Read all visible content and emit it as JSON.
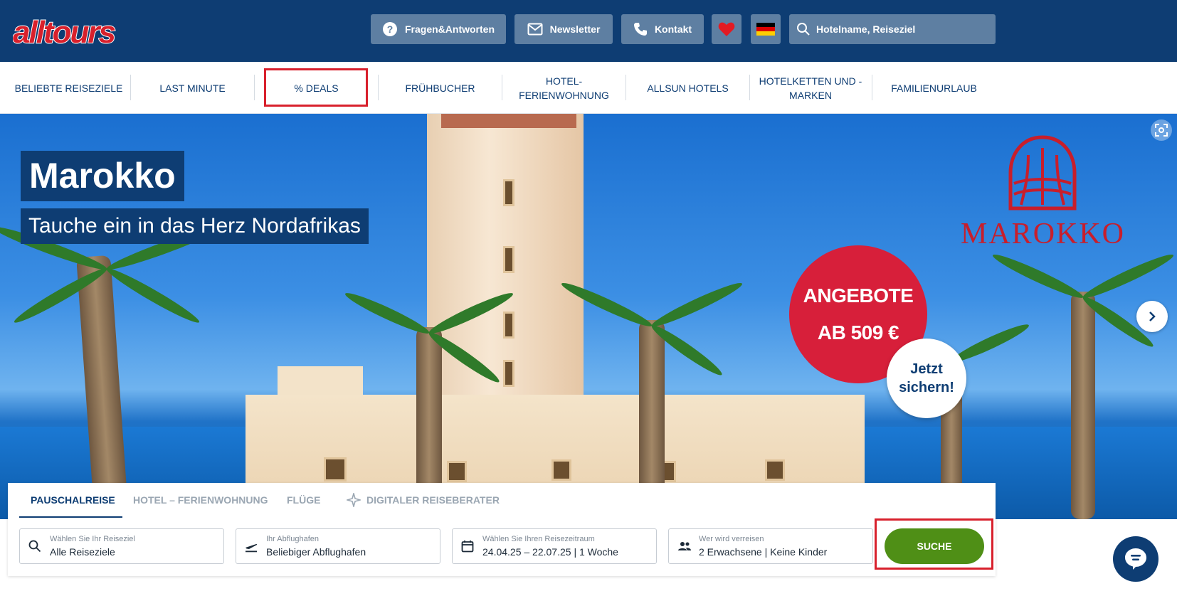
{
  "header": {
    "logo_text": "alltours",
    "faq_label": "Fragen&Antworten",
    "newsletter_label": "Newsletter",
    "contact_label": "Kontakt",
    "search_placeholder": "Hotelname, Reiseziel"
  },
  "nav": {
    "items": [
      {
        "label": "BELIEBTE REISEZIELE"
      },
      {
        "label": "LAST MINUTE"
      },
      {
        "label": "% DEALS"
      },
      {
        "label": "FRÜHBUCHER"
      },
      {
        "label": "HOTEL-\nFERIENWOHNUNG"
      },
      {
        "label": "ALLSUN HOTELS"
      },
      {
        "label": "HOTELKETTEN UND -\nMARKEN"
      },
      {
        "label": "FAMILIENURLAUB"
      }
    ]
  },
  "hero": {
    "title": "Marokko",
    "subtitle": "Tauche ein in das Herz Nordafrikas",
    "brand": "MAROKKO",
    "offer_line1": "ANGEBOTE",
    "offer_line2": "AB 509 €",
    "cta_line1": "Jetzt",
    "cta_line2": "sichern!"
  },
  "search": {
    "tabs": [
      {
        "label": "PAUSCHALREISE"
      },
      {
        "label": "HOTEL – FERIENWOHNUNG"
      },
      {
        "label": "FLÜGE"
      },
      {
        "label": "DIGITALER REISEBERATER"
      }
    ],
    "destination": {
      "label": "Wählen Sie Ihr Reiseziel",
      "value": "Alle Reiseziele"
    },
    "airport": {
      "label": "Ihr Abflughafen",
      "value": "Beliebiger Abflughafen"
    },
    "period": {
      "label": "Wählen Sie Ihren Reisezeitraum",
      "value": "24.04.25 – 22.07.25 | 1 Woche"
    },
    "travelers": {
      "label": "Wer wird verreisen",
      "value": "2 Erwachsene | Keine Kinder"
    },
    "submit_label": "SUCHE"
  },
  "colors": {
    "primary": "#0e3d73",
    "accent_red": "#d8202c",
    "submit_green": "#4f8f16"
  }
}
